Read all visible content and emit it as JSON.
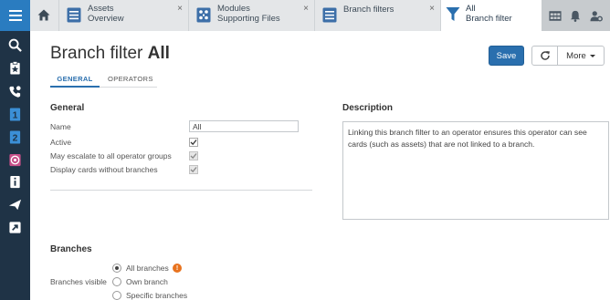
{
  "tabs": {
    "home_icon": "home-icon",
    "items": [
      {
        "line1": "Assets",
        "line2": "Overview",
        "icon": "list-document-icon"
      },
      {
        "line1": "Modules",
        "line2": "Supporting Files",
        "icon": "modules-grid-icon"
      },
      {
        "line1": "Branch filters",
        "line2": "",
        "icon": "list-document-icon"
      },
      {
        "line1": "All",
        "line2": "Branch filter",
        "icon": "funnel-icon"
      }
    ],
    "close_glyph": "×"
  },
  "page": {
    "title_prefix": "Branch filter",
    "title_bold": "All"
  },
  "actions": {
    "save_label": "Save",
    "more_label": "More"
  },
  "subtabs": {
    "general": "GENERAL",
    "operators": "OPERATORS"
  },
  "general": {
    "heading": "General",
    "name_label": "Name",
    "name_value": "All",
    "active_label": "Active",
    "active_checked": true,
    "escalate_label": "May escalate to all operator groups",
    "escalate_checked": true,
    "display_label": "Display cards without branches",
    "display_checked": true
  },
  "description": {
    "heading": "Description",
    "text": "Linking this branch filter to an operator ensures this operator can see cards (such as assets) that are not linked to a branch."
  },
  "branches": {
    "heading": "Branches",
    "visible_label": "Branches visible",
    "options": [
      "All branches",
      "Own branch",
      "Specific branches"
    ],
    "selected": "All branches",
    "info_glyph": "!"
  },
  "colors": {
    "sidebar": "#1f3346",
    "accent": "#2a6fae",
    "warning": "#e8731f"
  }
}
